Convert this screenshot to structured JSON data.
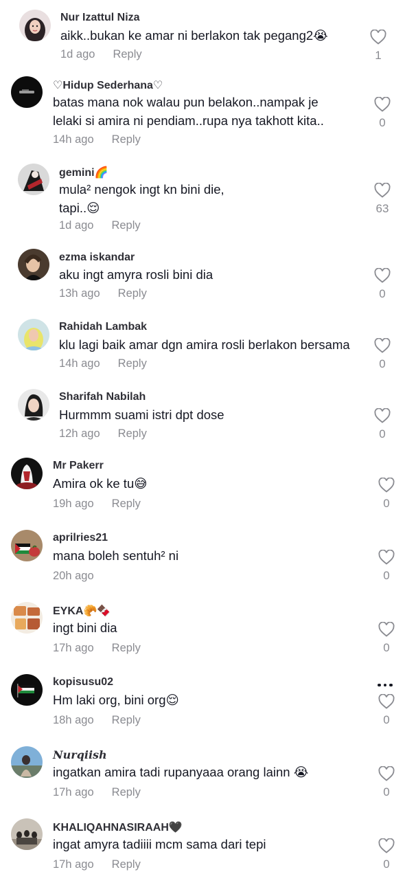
{
  "comments": [
    {
      "avatar": "avatar-hijab-illustration",
      "username": "Nur Izattul Niza",
      "lines": [
        "aikk..bukan ke amar ni berlakon tak pegang2😭"
      ],
      "time": "1d ago",
      "reply": "Reply",
      "likes": "1"
    },
    {
      "avatar": "avatar-black-car",
      "username": "♡Hidup Sederhana♡",
      "lines": [
        "batas mana nok walau pun belakon..nampak je",
        "lelaki si amira ni pendiam..rupa nya takhott kita.."
      ],
      "time": "14h ago",
      "reply": "Reply",
      "likes": "0"
    },
    {
      "avatar": "avatar-anime-figure",
      "username": "gemini🌈",
      "lines": [
        "mula² nengok ingt kn bini die,",
        "tapi..😌"
      ],
      "time": "1d ago",
      "reply": "Reply",
      "likes": "63"
    },
    {
      "avatar": "avatar-woman-photo",
      "username": "ezma iskandar",
      "lines": [
        "aku ingt amyra rosli bini dia"
      ],
      "time": "13h ago",
      "reply": "Reply",
      "likes": "0"
    },
    {
      "avatar": "avatar-yellow-hijab",
      "username": "Rahidah Lambak",
      "lines": [
        "klu lagi baik amar dgn amira rosli berlakon bersama"
      ],
      "time": "14h ago",
      "reply": "Reply",
      "likes": "0"
    },
    {
      "avatar": "avatar-woman-portrait",
      "username": "Sharifah Nabilah",
      "lines": [
        "Hurmmm suami istri dpt dose"
      ],
      "time": "12h ago",
      "reply": "Reply",
      "likes": "0"
    },
    {
      "avatar": "avatar-dark-figure",
      "username": "Mr Pakerr",
      "lines": [
        "Amira ok ke tu😅"
      ],
      "time": "19h ago",
      "reply": "Reply",
      "likes": "0"
    },
    {
      "avatar": "avatar-palestine-flag-fruit",
      "username": "aprilries21",
      "lines": [
        "mana boleh sentuh² ni"
      ],
      "time": "20h ago",
      "reply": "Reply",
      "likes": "0"
    },
    {
      "avatar": "avatar-food-table",
      "username": "EYKA🥐🍫",
      "lines": [
        "ingt bini dia"
      ],
      "time": "17h ago",
      "reply": "Reply",
      "likes": "0"
    },
    {
      "avatar": "avatar-palestine-flag",
      "username": "kopisusu02",
      "lines": [
        "Hm laki org, bini org😌"
      ],
      "time": "18h ago",
      "reply": "Reply",
      "likes": "0"
    },
    {
      "avatar": "avatar-hijab-street",
      "username": "𝑵𝒖𝒓𝒒𝒊𝒊𝒔𝒉",
      "lines": [
        "ingatkan amira tadi rupanyaaa orang lainn 😭"
      ],
      "time": "17h ago",
      "reply": "Reply",
      "likes": "0"
    },
    {
      "avatar": "avatar-group-photo",
      "username": "KHALIQAHNASIRAAH🖤",
      "lines": [
        "ingat amyra tadiiii mcm sama dari tepi"
      ],
      "time": "17h ago",
      "reply": "Reply",
      "likes": "0"
    }
  ],
  "icons": {
    "like": "heart-outline-icon",
    "more": "more-options-icon"
  },
  "colors": {
    "text": "#161823",
    "meta": "#8a8b91",
    "username": "#2f2f36",
    "background": "#ffffff"
  }
}
